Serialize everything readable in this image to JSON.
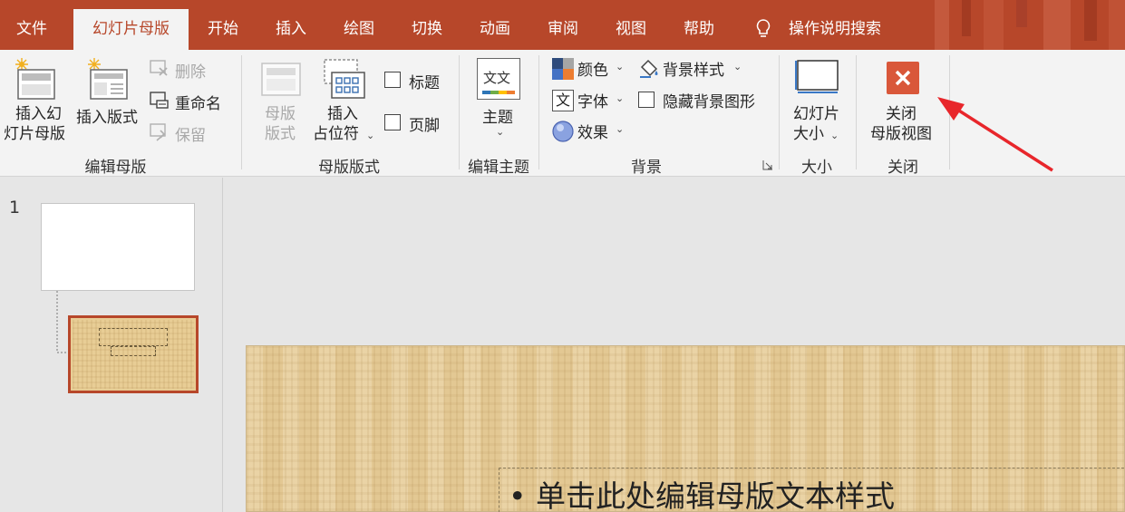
{
  "tabs": [
    {
      "label": "文件",
      "active": false
    },
    {
      "label": "幻灯片母版",
      "active": true
    },
    {
      "label": "开始",
      "active": false
    },
    {
      "label": "插入",
      "active": false
    },
    {
      "label": "绘图",
      "active": false
    },
    {
      "label": "切换",
      "active": false
    },
    {
      "label": "动画",
      "active": false
    },
    {
      "label": "审阅",
      "active": false
    },
    {
      "label": "视图",
      "active": false
    },
    {
      "label": "帮助",
      "active": false
    }
  ],
  "tell_me": {
    "label": "操作说明搜索",
    "icon": "lightbulb-icon"
  },
  "ribbon": {
    "edit_master": {
      "insert_slide_master": [
        "插入幻",
        "灯片母版"
      ],
      "insert_layout": "插入版式",
      "delete": "删除",
      "rename": "重命名",
      "preserve": "保留",
      "group_label": "编辑母版"
    },
    "master_layout": {
      "master_layout_button": [
        "母版",
        "版式"
      ],
      "insert_placeholder": [
        "插入",
        "占位符"
      ],
      "title_checkbox": "标题",
      "footer_checkbox": "页脚",
      "group_label": "母版版式"
    },
    "edit_theme": {
      "themes": "主题",
      "theme_icon_text": "文文",
      "group_label": "编辑主题"
    },
    "background": {
      "colors": "颜色",
      "fonts": "字体",
      "fonts_icon_text": "文",
      "effects": "效果",
      "background_styles": "背景样式",
      "hide_background_graphics": "隐藏背景图形",
      "group_label": "背景"
    },
    "size": {
      "slide_size": [
        "幻灯片",
        "大小"
      ],
      "group_label": "大小"
    },
    "close": {
      "close_master_view": [
        "关闭",
        "母版视图"
      ],
      "group_label": "关闭"
    }
  },
  "colors": {
    "accent": "#b7472a",
    "close_button": "#d9573a",
    "annotation_arrow": "#e8262b",
    "slide_background": "#e3c893"
  },
  "thumbnails": {
    "slide_number": "1"
  },
  "slide": {
    "bullet_text": "单击此处编辑母版文本样式"
  }
}
